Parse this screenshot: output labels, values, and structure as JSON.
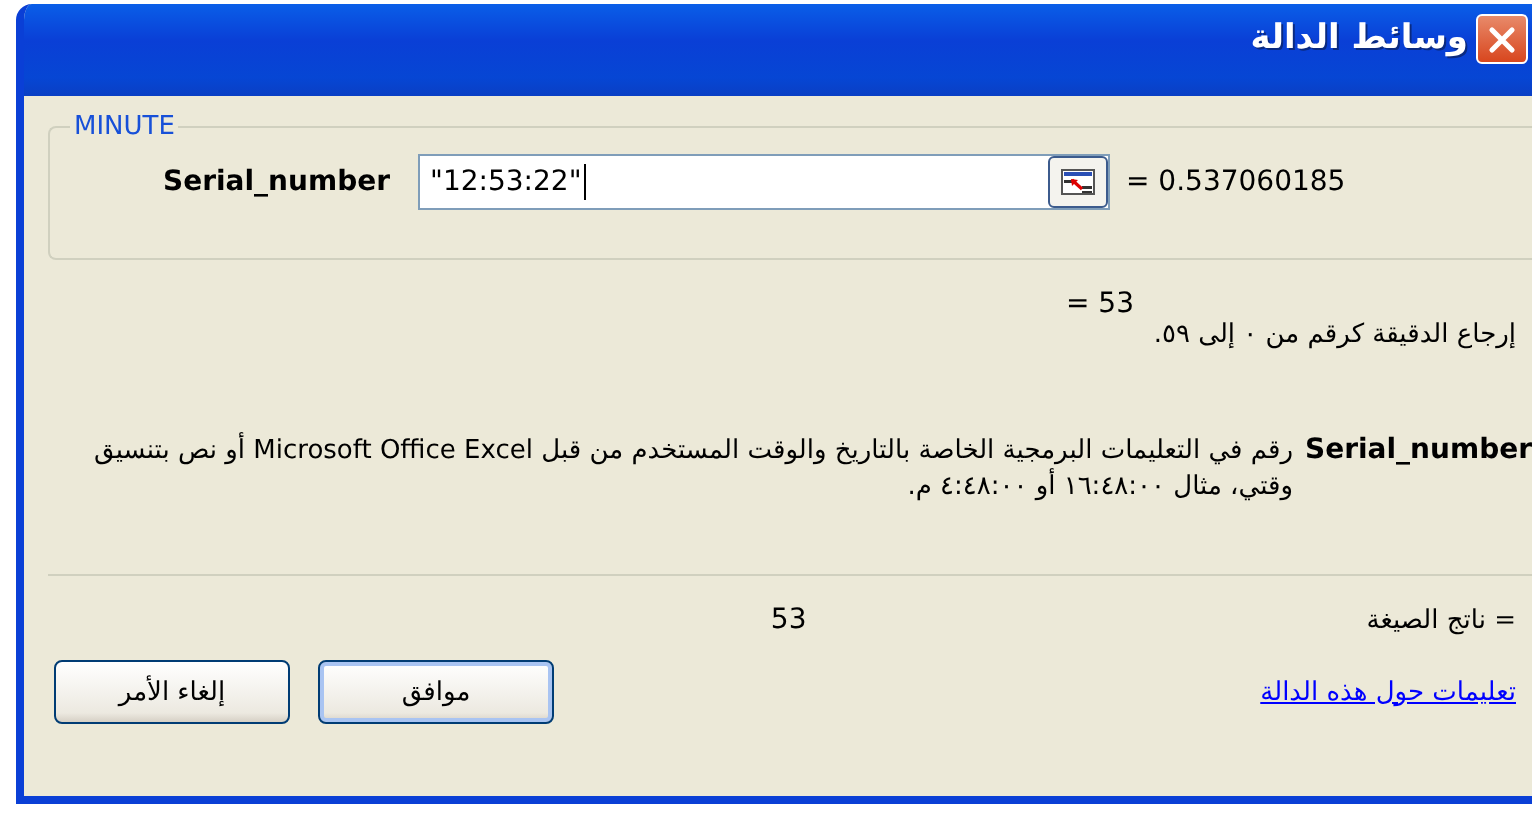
{
  "window": {
    "title": "وسائط الدالة"
  },
  "function_name": "MINUTE",
  "arguments": [
    {
      "name": "Serial_number",
      "value": "\"12:53:22\"",
      "result": "= 0.537060185"
    }
  ],
  "function_result": "= 53",
  "description": "إرجاع الدقيقة كرقم من ٠ إلى ٥٩.",
  "argument_help": {
    "name": "Serial_number",
    "text": "رقم في التعليمات البرمجية الخاصة بالتاريخ والوقت المستخدم من قبل Microsoft Office Excel أو نص بتنسيق وقتي، مثال ١٦:٤٨:٠٠ أو ٤:٤٨:٠٠ م."
  },
  "formula_result": {
    "label": "ناتج الصيغة =",
    "value": "53"
  },
  "help_link": "تعليمات حول هذه الدالة",
  "buttons": [
    {
      "label": "موافق",
      "kind": "default"
    },
    {
      "label": "إلغاء الأمر",
      "kind": "normal"
    }
  ]
}
